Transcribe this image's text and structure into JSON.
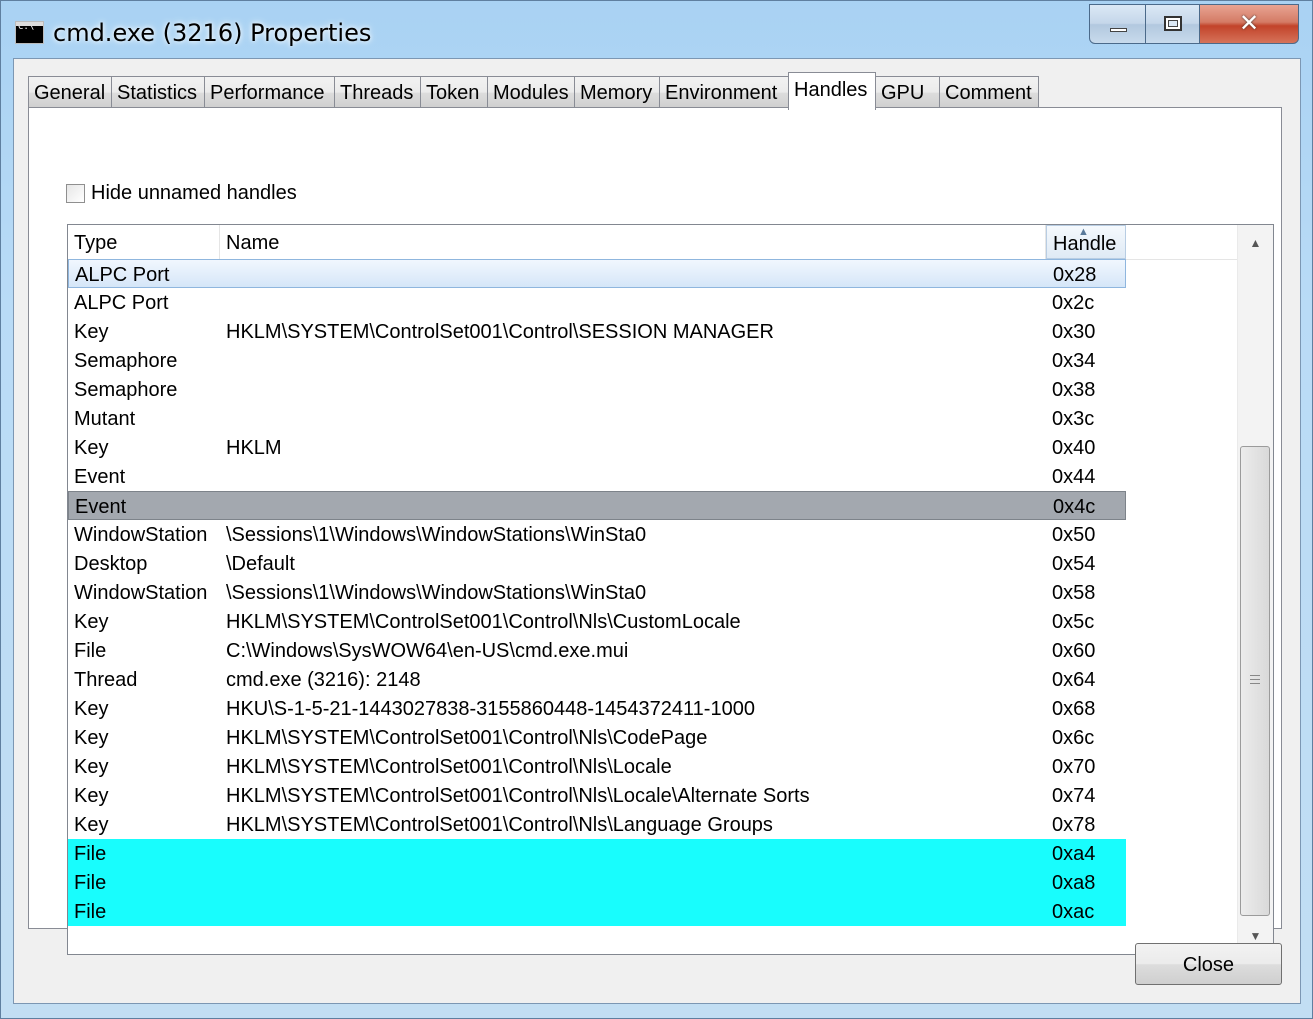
{
  "window": {
    "title": "cmd.exe (3216) Properties",
    "icon": "console-icon",
    "icon_text": "C:\\"
  },
  "caption": {
    "close_glyph": "✕"
  },
  "tabs": [
    {
      "label": "General"
    },
    {
      "label": "Statistics"
    },
    {
      "label": "Performance"
    },
    {
      "label": "Threads"
    },
    {
      "label": "Token"
    },
    {
      "label": "Modules"
    },
    {
      "label": "Memory"
    },
    {
      "label": "Environment"
    },
    {
      "label": "Handles",
      "active": true
    },
    {
      "label": "GPU"
    },
    {
      "label": "Comment"
    }
  ],
  "options": {
    "hide_unnamed_label": "Hide unnamed handles",
    "hide_unnamed_checked": false
  },
  "list": {
    "columns": [
      {
        "label": "Type"
      },
      {
        "label": "Name"
      },
      {
        "label": "Handle",
        "sorted": "ascending"
      }
    ],
    "rows": [
      {
        "type": "ALPC Port",
        "name": "",
        "handle": "0x28",
        "highlight": "focus"
      },
      {
        "type": "ALPC Port",
        "name": "",
        "handle": "0x2c"
      },
      {
        "type": "Key",
        "name": "HKLM\\SYSTEM\\ControlSet001\\Control\\SESSION MANAGER",
        "handle": "0x30"
      },
      {
        "type": "Semaphore",
        "name": "",
        "handle": "0x34"
      },
      {
        "type": "Semaphore",
        "name": "",
        "handle": "0x38"
      },
      {
        "type": "Mutant",
        "name": "",
        "handle": "0x3c"
      },
      {
        "type": "Key",
        "name": "HKLM",
        "handle": "0x40"
      },
      {
        "type": "Event",
        "name": "",
        "handle": "0x44"
      },
      {
        "type": "Event",
        "name": "",
        "handle": "0x4c",
        "highlight": "gray"
      },
      {
        "type": "WindowStation",
        "name": "\\Sessions\\1\\Windows\\WindowStations\\WinSta0",
        "handle": "0x50"
      },
      {
        "type": "Desktop",
        "name": "\\Default",
        "handle": "0x54"
      },
      {
        "type": "WindowStation",
        "name": "\\Sessions\\1\\Windows\\WindowStations\\WinSta0",
        "handle": "0x58"
      },
      {
        "type": "Key",
        "name": "HKLM\\SYSTEM\\ControlSet001\\Control\\Nls\\CustomLocale",
        "handle": "0x5c"
      },
      {
        "type": "File",
        "name": "C:\\Windows\\SysWOW64\\en-US\\cmd.exe.mui",
        "handle": "0x60"
      },
      {
        "type": "Thread",
        "name": "cmd.exe (3216): 2148",
        "handle": "0x64"
      },
      {
        "type": "Key",
        "name": "HKU\\S-1-5-21-1443027838-3155860448-1454372411-1000",
        "handle": "0x68"
      },
      {
        "type": "Key",
        "name": "HKLM\\SYSTEM\\ControlSet001\\Control\\Nls\\CodePage",
        "handle": "0x6c"
      },
      {
        "type": "Key",
        "name": "HKLM\\SYSTEM\\ControlSet001\\Control\\Nls\\Locale",
        "handle": "0x70"
      },
      {
        "type": "Key",
        "name": "HKLM\\SYSTEM\\ControlSet001\\Control\\Nls\\Locale\\Alternate Sorts",
        "handle": "0x74"
      },
      {
        "type": "Key",
        "name": "HKLM\\SYSTEM\\ControlSet001\\Control\\Nls\\Language Groups",
        "handle": "0x78"
      },
      {
        "type": "File",
        "name": "",
        "handle": "0xa4",
        "highlight": "cyan"
      },
      {
        "type": "File",
        "name": "",
        "handle": "0xa8",
        "highlight": "cyan"
      },
      {
        "type": "File",
        "name": "",
        "handle": "0xac",
        "highlight": "cyan"
      }
    ]
  },
  "buttons": {
    "close_label": "Close"
  },
  "colors": {
    "highlight_cyan": "#18fdfd",
    "highlight_gray": "#a3a8af",
    "selection_blue": "#d5e6f8"
  }
}
